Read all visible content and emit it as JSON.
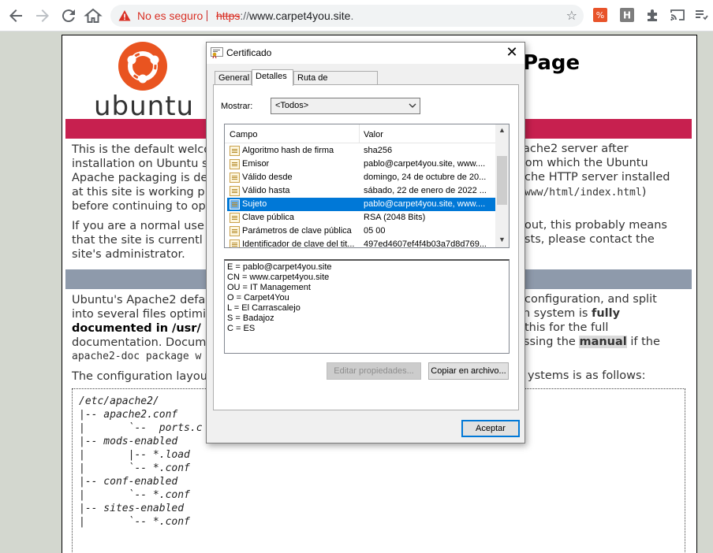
{
  "browser": {
    "not_secure": "No es seguro",
    "url_scheme": "https",
    "url_sep": "://",
    "url_host": "www.carpet4you.site",
    "url_end": "."
  },
  "page": {
    "logo_text": "ubuntu",
    "title_partial": "Page",
    "p1_lines": [
      "This is the default welco",
      "installation on Ubuntu s",
      "Apache packaging is de",
      "at this site is working p",
      "before continuing to op"
    ],
    "p1_right": [
      "ache2 server after",
      " from which the Ubuntu",
      "che HTTP server installed",
      "www/html/index.html",
      ")"
    ],
    "p2_lines": [
      "If you are a normal use",
      "that the site is currentl",
      "site's administrator."
    ],
    "p2_right": [
      "out, this probably means",
      "sts, please contact the"
    ],
    "p3_lines": [
      "Ubuntu's Apache2 defa",
      "into several files optimi",
      "documented in /usr/",
      "documentation. Docum",
      "apache2-doc package w"
    ],
    "p3_right": [
      " configuration, and split",
      "n system is ",
      "fully",
      " this for the full",
      "essing the ",
      "manual",
      " if the"
    ],
    "p4": "The configuration layou",
    "p4_right": "ystems is as follows:",
    "code": [
      "/etc/apache2/",
      "|-- apache2.conf",
      "|       `--  ports.c",
      "|-- mods-enabled",
      "|       |-- *.load",
      "|       `-- *.conf",
      "|-- conf-enabled",
      "|       `-- *.conf",
      "|-- sites-enabled",
      "|       `-- *.conf"
    ]
  },
  "dialog": {
    "title": "Certificado",
    "tabs": [
      "General",
      "Detalles",
      "Ruta de certificación"
    ],
    "active_tab": "Detalles",
    "mostrar_label": "Mostrar:",
    "mostrar_value": "<Todos>",
    "col_campo": "Campo",
    "col_valor": "Valor",
    "rows": [
      {
        "field": "Algoritmo hash de firma",
        "value": "sha256"
      },
      {
        "field": "Emisor",
        "value": "pablo@carpet4you.site, www...."
      },
      {
        "field": "Válido desde",
        "value": "domingo, 24 de octubre de 20..."
      },
      {
        "field": "Válido hasta",
        "value": "sábado, 22 de enero de 2022 ..."
      },
      {
        "field": "Sujeto",
        "value": "pablo@carpet4you.site, www...."
      },
      {
        "field": "Clave pública",
        "value": "RSA (2048 Bits)"
      },
      {
        "field": "Parámetros de clave pública",
        "value": "05 00"
      },
      {
        "field": "Identificador de clave del tit...",
        "value": "497ed4607ef4f4b03a7d8d769..."
      }
    ],
    "selected_row": "Sujeto",
    "details": [
      "E = pablo@carpet4you.site",
      "CN = www.carpet4you.site",
      "OU = IT Management",
      "O = Carpet4You",
      "L = El Carrascalejo",
      "S = Badajoz",
      "C = ES"
    ],
    "btn_edit": "Editar propiedades...",
    "btn_copy": "Copiar en archivo...",
    "btn_ok": "Aceptar"
  },
  "colors": {
    "ubuntu_orange": "#e95420",
    "banner_red": "#c7204f",
    "banner_gray": "#8e9aab",
    "selection_blue": "#0078d7",
    "warning_red": "#d93025"
  }
}
